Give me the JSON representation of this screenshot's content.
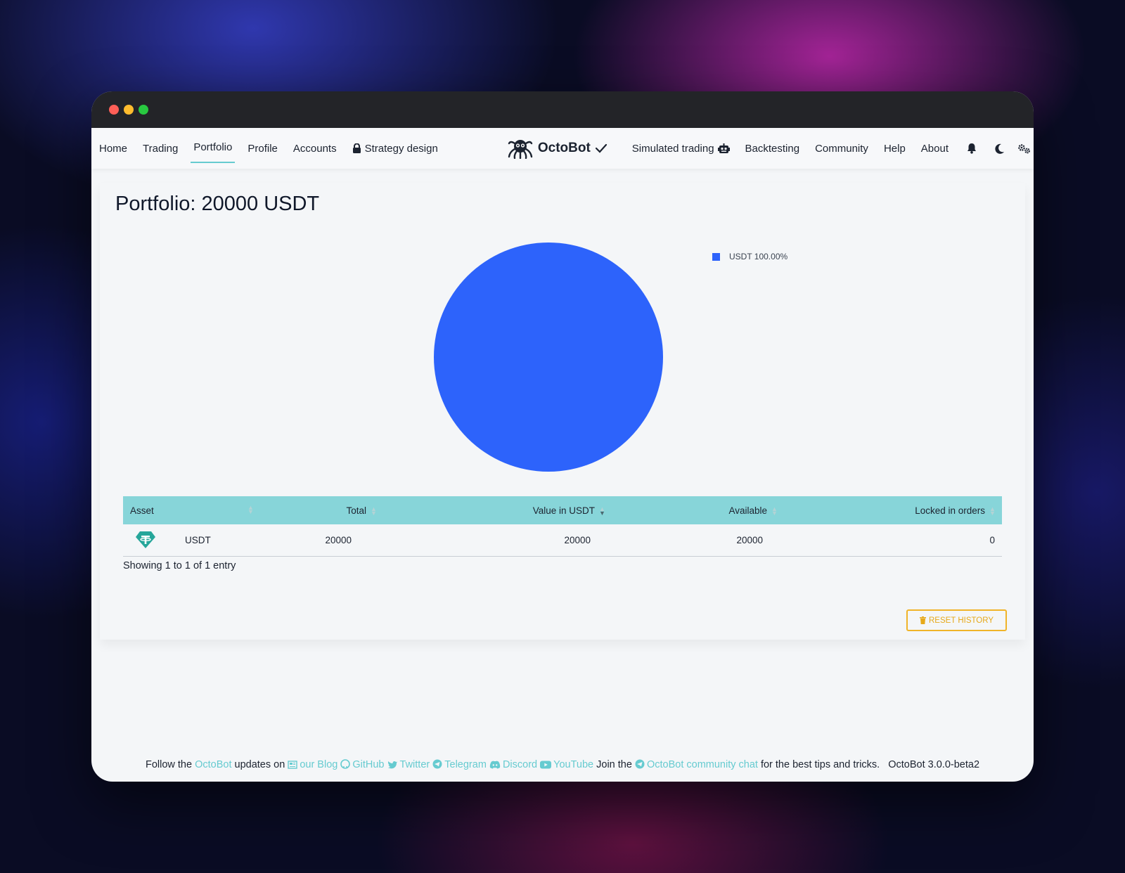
{
  "nav": {
    "left": [
      "Home",
      "Trading",
      "Portfolio",
      "Profile",
      "Accounts",
      "Strategy design"
    ],
    "brand": "OctoBot",
    "right": [
      "Simulated trading",
      "Backtesting",
      "Community",
      "Help",
      "About"
    ],
    "active": "Portfolio"
  },
  "page": {
    "title": "Portfolio: 20000 USDT"
  },
  "chart_data": {
    "type": "pie",
    "labels": [
      "USDT"
    ],
    "values": [
      100
    ],
    "legend": [
      "USDT 100.00%"
    ],
    "legend_position": "top-right",
    "colors": [
      "#2d63fb"
    ]
  },
  "table": {
    "headers": [
      "Asset",
      "Total",
      "Value in USDT",
      "Available",
      "Locked in orders"
    ],
    "rows": [
      {
        "icon": "tether-icon",
        "asset": "USDT",
        "total": "20000",
        "value": "20000",
        "available": "20000",
        "locked": "0"
      }
    ],
    "info": "Showing 1 to 1 of 1 entry"
  },
  "reset_button": "RESET HISTORY",
  "footer": {
    "t1": "Follow the",
    "l1": "OctoBot",
    "t2": "updates on",
    "blog": "our Blog",
    "github": "GitHub",
    "twitter": "Twitter",
    "telegram": "Telegram",
    "discord": "Discord",
    "youtube": "YouTube",
    "t3": "Join the",
    "chat": "OctoBot community chat",
    "t4": "for the best tips and tricks.",
    "version": "OctoBot 3.0.0-beta2"
  },
  "colors": {
    "accent": "#66cbd0",
    "table_header": "#87d5d9",
    "pie": "#2d63fb",
    "warning": "#f0b429"
  }
}
